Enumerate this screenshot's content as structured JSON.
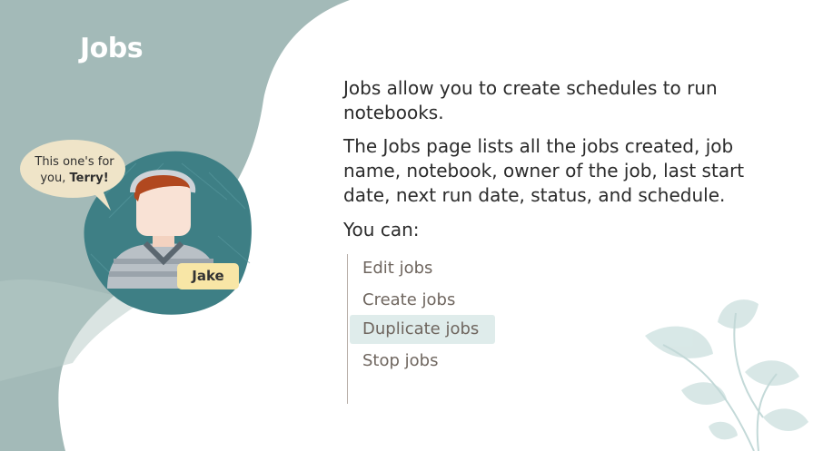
{
  "slide": {
    "title": "Jobs"
  },
  "character": {
    "bubble_line1": "This one's for",
    "bubble_line2_prefix": "you, ",
    "bubble_name": "Terry!",
    "name_tag": "Jake"
  },
  "content": {
    "paragraph1": "Jobs allow you to create schedules to run notebooks.",
    "paragraph2": "The Jobs page lists all the jobs created, job name, notebook, owner of the job, last start date, next run date, status, and schedule.",
    "paragraph3": "You can:",
    "list": [
      {
        "label": "Edit jobs"
      },
      {
        "label": "Create jobs"
      },
      {
        "label": "Duplicate jobs"
      },
      {
        "label": "Stop jobs"
      }
    ]
  },
  "colors": {
    "panel": "#9cb5b2",
    "avatar_bg": "#3e7f85",
    "highlight": "#dfeceb",
    "name_tag": "#f8e6a6"
  }
}
